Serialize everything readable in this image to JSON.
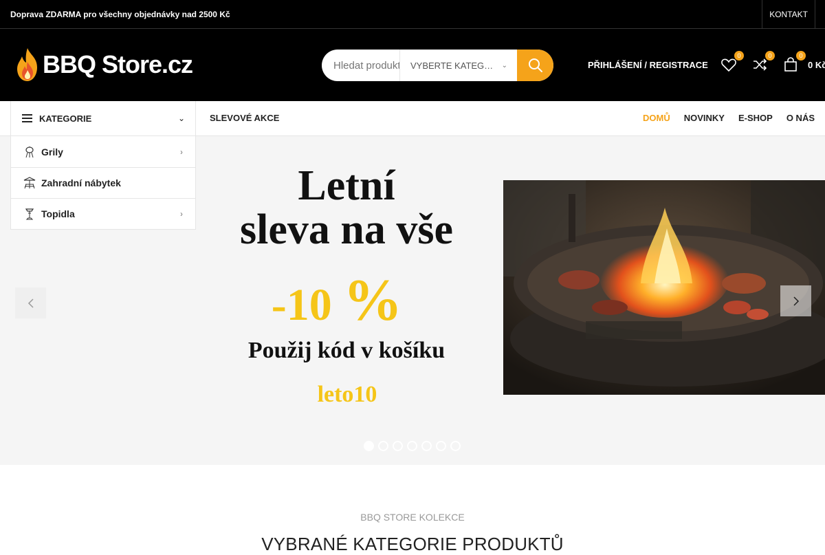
{
  "topbar": {
    "promo": "Doprava ZDARMA pro všechny objednávky nad 2500 Kč",
    "contact": "KONTAKT"
  },
  "header": {
    "logo_text": "BBQ Store.cz",
    "search": {
      "placeholder": "Hledat produkty",
      "category_select": "VYBERTE KATEG…"
    },
    "account_link": "PŘIHLÁŠENÍ / REGISTRACE",
    "wishlist_count": "0",
    "compare_count": "0",
    "cart_count": "0",
    "cart_total": "0 Kč"
  },
  "nav": {
    "categories_label": "KATEGORIE",
    "promo_link": "SLEVOVÉ AKCE",
    "items": [
      {
        "label": "DOMŮ",
        "active": true
      },
      {
        "label": "NOVINKY"
      },
      {
        "label": "E-SHOP"
      },
      {
        "label": "O NÁS"
      }
    ]
  },
  "category_menu": [
    {
      "label": "Grily",
      "has_submenu": true,
      "icon": "grill-icon"
    },
    {
      "label": "Zahradní nábytek",
      "has_submenu": false,
      "icon": "garden-furniture-icon"
    },
    {
      "label": "Topidla",
      "has_submenu": true,
      "icon": "heater-icon"
    }
  ],
  "slider": {
    "headline_line1": "Letní",
    "headline_line2": "sleva na vše",
    "discount": "-10",
    "percent": "%",
    "code_label": "Použij kód v košíku",
    "code": "leto10",
    "dot_count": 7,
    "active_dot": 0
  },
  "section": {
    "subtitle": "BBQ STORE KOLEKCE",
    "title": "VYBRANÉ KATEGORIE PRODUKTŮ"
  },
  "colors": {
    "accent": "#f5a31a",
    "promo_yellow": "#f5c518",
    "dark": "#000000"
  }
}
